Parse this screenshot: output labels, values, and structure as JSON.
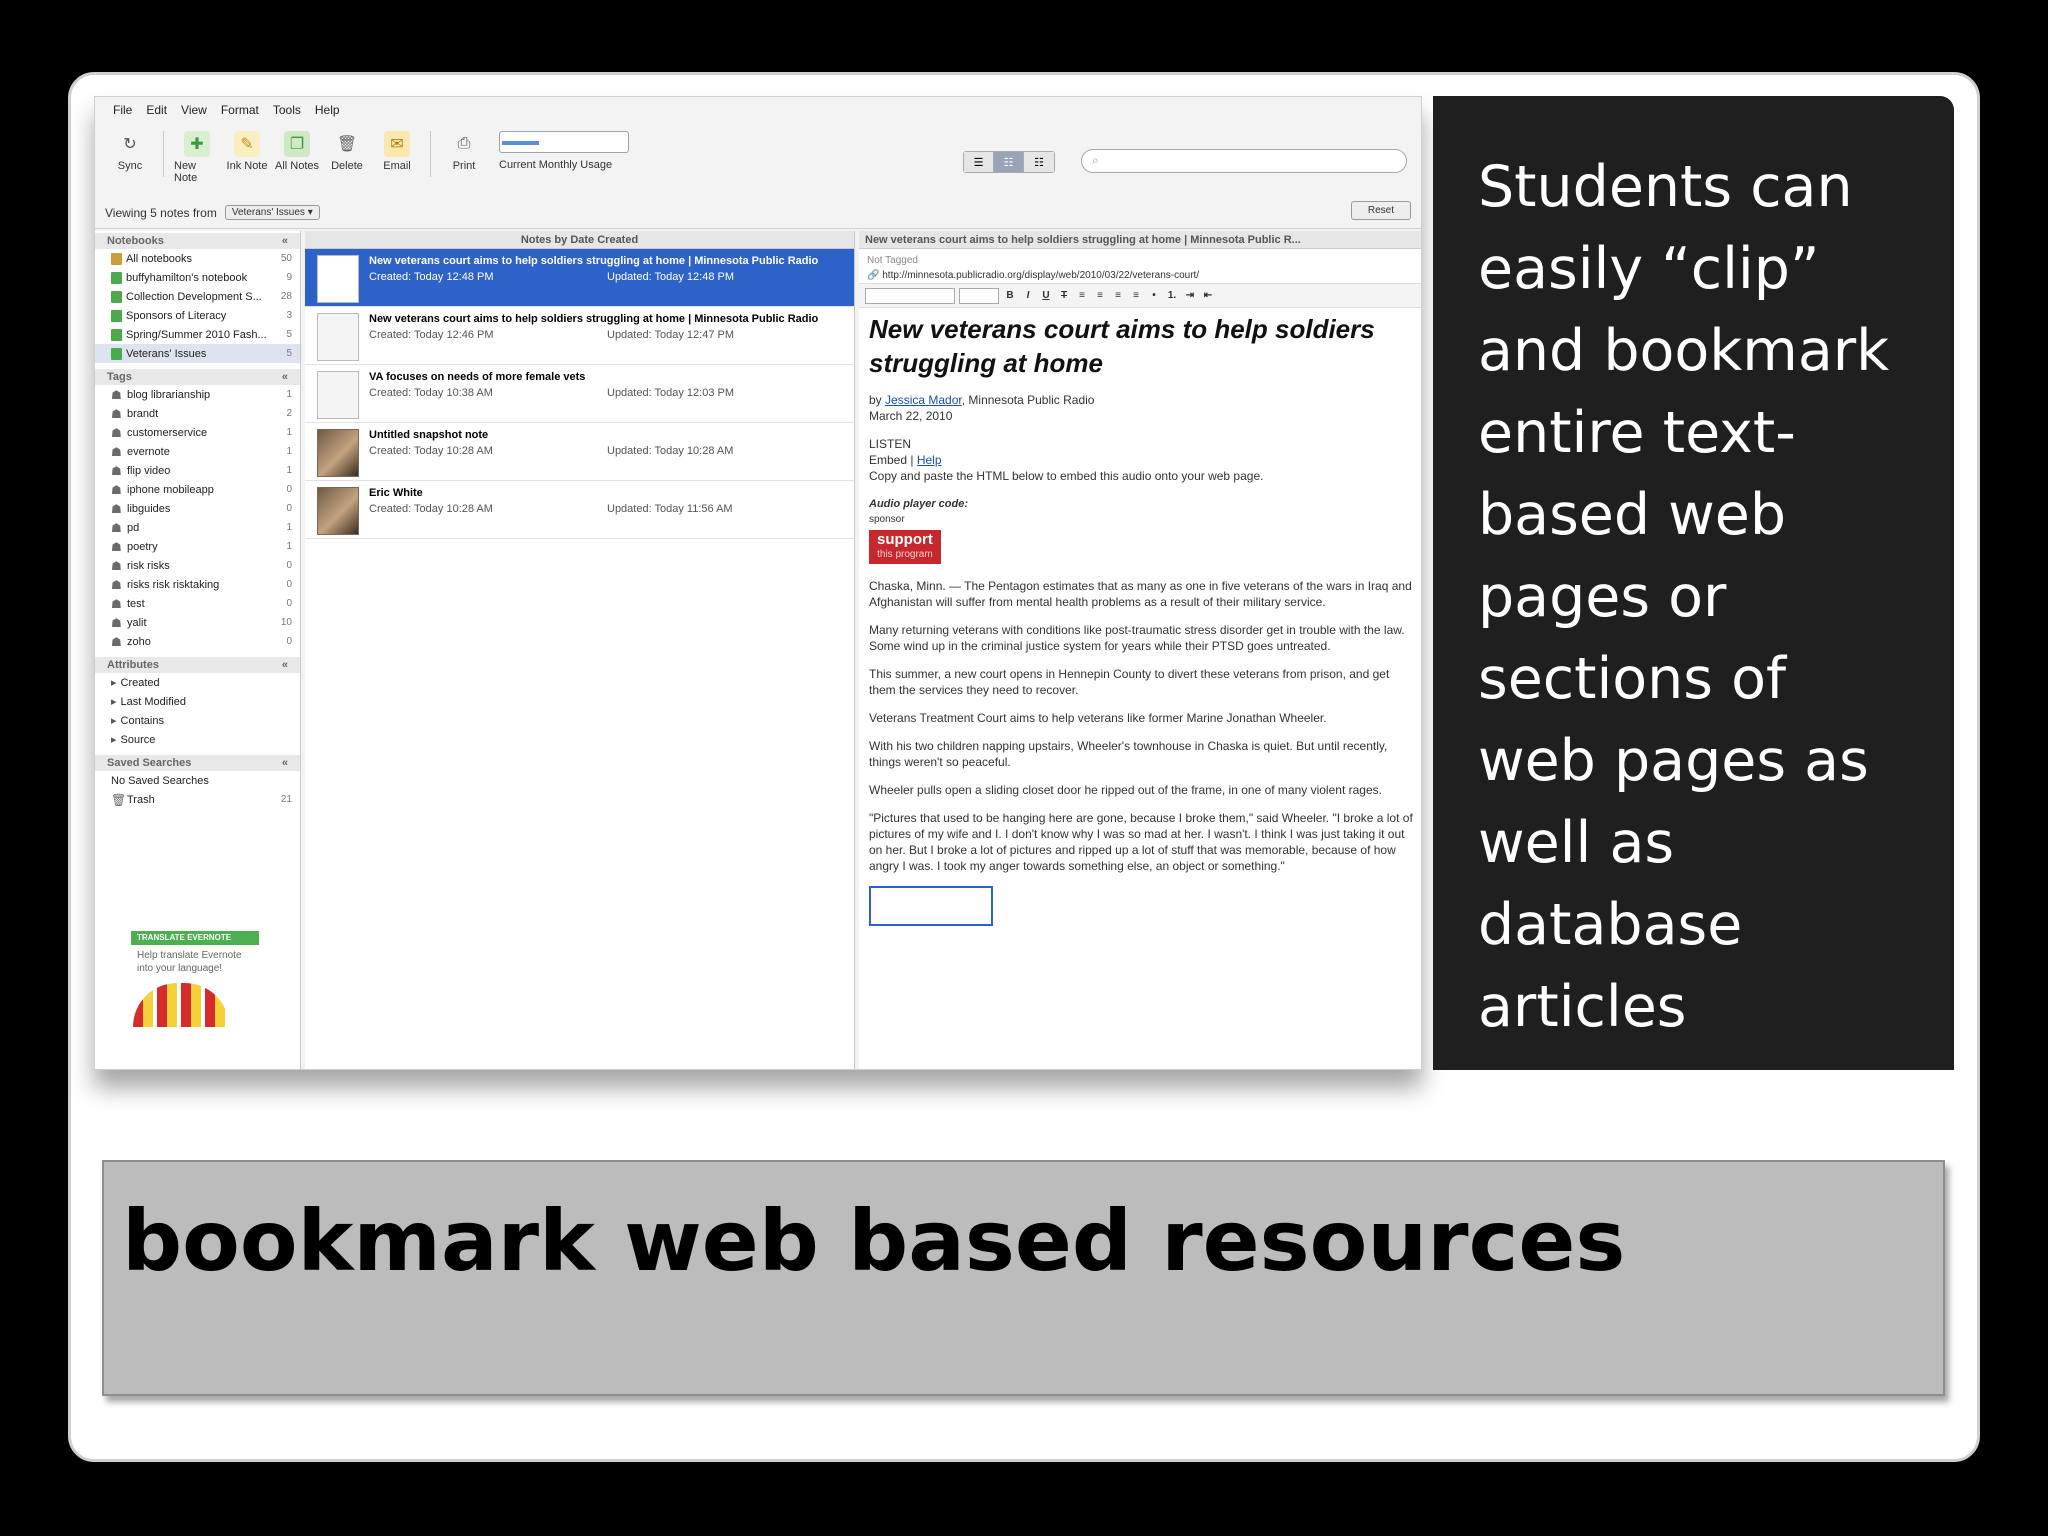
{
  "slide": {
    "title": "bookmark web based resources",
    "caption": "Students can easily “clip” and bookmark entire text-based web pages or sections of web pages as well as database articles"
  },
  "app": {
    "menu": [
      "File",
      "Edit",
      "View",
      "Format",
      "Tools",
      "Help"
    ],
    "toolbar": [
      {
        "label": "Sync",
        "icon": "sync-icon"
      },
      {
        "label": "New Note",
        "icon": "new-note-icon"
      },
      {
        "label": "Ink Note",
        "icon": "ink-note-icon"
      },
      {
        "label": "All Notes",
        "icon": "all-notes-icon"
      },
      {
        "label": "Delete",
        "icon": "trash-icon"
      },
      {
        "label": "Email",
        "icon": "email-icon"
      },
      {
        "label": "Print",
        "icon": "print-icon"
      }
    ],
    "usage_label": "Current Monthly Usage",
    "usage_fraction": 0.3,
    "filter_prefix": "Viewing 5 notes from",
    "filter_value": "Veterans' Issues",
    "reset_label": "Reset",
    "sidebar": {
      "notebooks_head": "Notebooks",
      "notebooks": [
        {
          "label": "All notebooks",
          "count": "50"
        },
        {
          "label": "buffyhamilton's notebook",
          "count": "9"
        },
        {
          "label": "Collection Development S...",
          "count": "28"
        },
        {
          "label": "Sponsors of Literacy",
          "count": "3"
        },
        {
          "label": "Spring/Summer 2010 Fash...",
          "count": "5"
        },
        {
          "label": "Veterans' Issues",
          "count": "5"
        }
      ],
      "tags_head": "Tags",
      "tags": [
        {
          "label": "blog librarianship",
          "count": "1"
        },
        {
          "label": "brandt",
          "count": "2"
        },
        {
          "label": "customerservice",
          "count": "1"
        },
        {
          "label": "evernote",
          "count": "1"
        },
        {
          "label": "flip video",
          "count": "1"
        },
        {
          "label": "iphone mobileapp",
          "count": "0"
        },
        {
          "label": "libguides",
          "count": "0"
        },
        {
          "label": "pd",
          "count": "1"
        },
        {
          "label": "poetry",
          "count": "1"
        },
        {
          "label": "risk risks",
          "count": "0"
        },
        {
          "label": "risks risk risktaking",
          "count": "0"
        },
        {
          "label": "test",
          "count": "0"
        },
        {
          "label": "yalit",
          "count": "10"
        },
        {
          "label": "zoho",
          "count": "0"
        }
      ],
      "attributes_head": "Attributes",
      "attributes": [
        "Created",
        "Last Modified",
        "Contains",
        "Source"
      ],
      "saved_head": "Saved Searches",
      "saved_empty": "No Saved Searches",
      "trash_label": "Trash",
      "trash_count": "21",
      "promo_head": "TRANSLATE EVERNOTE",
      "promo_text": "Help translate Evernote into your language!"
    },
    "notes_head": "Notes by Date Created",
    "notes": [
      {
        "title": "New veterans court aims to help soldiers struggling at home | Minnesota Public Radio",
        "created": "Created: Today 12:48 PM",
        "updated": "Updated: Today 12:48 PM",
        "thumb": "page"
      },
      {
        "title": "New veterans court aims to help soldiers struggling at home | Minnesota Public Radio",
        "created": "Created: Today 12:46 PM",
        "updated": "Updated: Today 12:47 PM",
        "thumb": "page"
      },
      {
        "title": "VA focuses on needs of more female vets",
        "created": "Created: Today 10:38 AM",
        "updated": "Updated: Today 12:03 PM",
        "thumb": "page"
      },
      {
        "title": "Untitled snapshot note",
        "created": "Created: Today 10:28 AM",
        "updated": "Updated: Today 10:28 AM",
        "thumb": "photo"
      },
      {
        "title": "Eric White",
        "created": "Created: Today 10:28 AM",
        "updated": "Updated: Today 11:56 AM",
        "thumb": "photo"
      }
    ],
    "content": {
      "head": "New veterans court aims to help soldiers struggling at home | Minnesota Public R...",
      "tags": "Not Tagged",
      "url": "http://minnesota.publicradio.org/display/web/2010/03/22/veterans-court/",
      "headline": "New veterans court aims to help soldiers struggling at home",
      "byline_prefix": "by",
      "author": "Jessica Mador",
      "byline_suffix": ", Minnesota Public Radio",
      "date": "March 22, 2010",
      "listen": "LISTEN",
      "embed": "Embed |",
      "help": "Help",
      "embed_text": "Copy and paste the HTML below to embed this audio onto your web page.",
      "audio_label": "Audio player code:",
      "sponsor": "sponsor",
      "support_1": "support",
      "support_2": "this program",
      "paragraphs": [
        "Chaska, Minn. — The Pentagon estimates that as many as one in five veterans of the wars in Iraq and Afghanistan will suffer from mental health problems as a result of their military service.",
        "Many returning veterans with conditions like post-traumatic stress disorder get in trouble with the law. Some wind up in the criminal justice system for years while their PTSD goes untreated.",
        "This summer, a new court opens in Hennepin County to divert these veterans from prison, and get them the services they need to recover.",
        "Veterans Treatment Court aims to help veterans like former Marine Jonathan Wheeler.",
        "With his two children napping upstairs, Wheeler's townhouse in Chaska is quiet. But until recently, things weren't so peaceful.",
        "Wheeler pulls open a sliding closet door he ripped out of the frame, in one of many violent rages.",
        "\"Pictures that used to be hanging here are gone, because I broke them,\" said Wheeler. \"I broke a lot of pictures of my wife and I. I don't know why I was so mad at her. I wasn't. I think I was just taking it out on her. But I broke a lot of pictures and ripped up a lot of stuff that was memorable, because of how angry I was. I took my anger towards something else, an object or something.\""
      ]
    }
  }
}
